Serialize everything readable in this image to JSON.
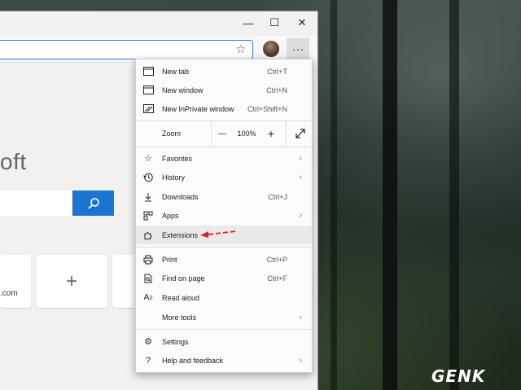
{
  "window_controls": {
    "minimize": "—",
    "maximize": "☐",
    "close": "✕"
  },
  "toolbar": {
    "more_label": "···"
  },
  "page": {
    "brand_text": "oft",
    "tile_label": ".com"
  },
  "menu": {
    "items": [
      {
        "label": "New tab",
        "shortcut": "Ctrl+T"
      },
      {
        "label": "New window",
        "shortcut": "Ctrl+N"
      },
      {
        "label": "New InPrivate window",
        "shortcut": "Ctrl+Shift+N"
      },
      {
        "label": "Zoom",
        "value": "100%"
      },
      {
        "label": "Favorites"
      },
      {
        "label": "History"
      },
      {
        "label": "Downloads",
        "shortcut": "Ctrl+J"
      },
      {
        "label": "Apps"
      },
      {
        "label": "Extensions"
      },
      {
        "label": "Print",
        "shortcut": "Ctrl+P"
      },
      {
        "label": "Find on page",
        "shortcut": "Ctrl+F"
      },
      {
        "label": "Read aloud"
      },
      {
        "label": "More tools"
      },
      {
        "label": "Settings"
      },
      {
        "label": "Help and feedback"
      }
    ],
    "zoom_minus": "—",
    "zoom_plus": "+"
  },
  "colors": {
    "accent": "#1a74d2",
    "annotation": "#e02020",
    "highlight": "#e9e9e9"
  },
  "watermark": {
    "text": "GENK"
  }
}
